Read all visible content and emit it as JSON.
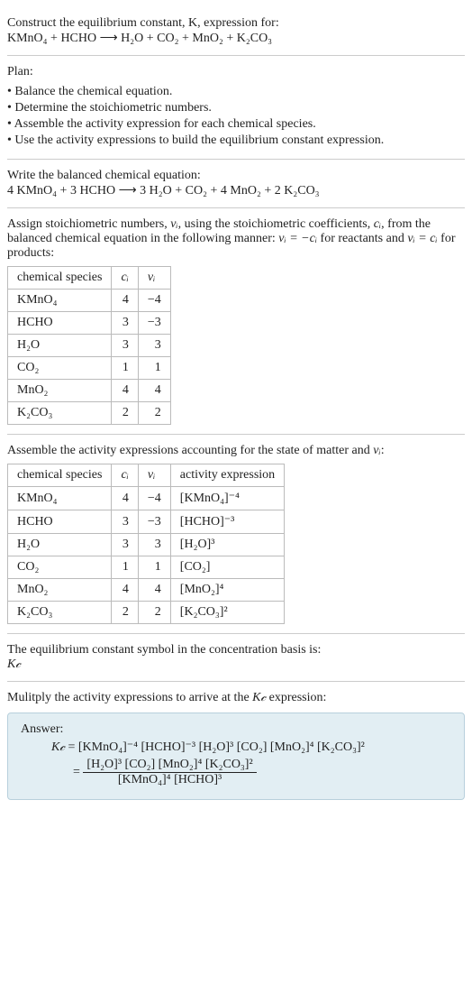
{
  "title": {
    "line1": "Construct the equilibrium constant, K, expression for:",
    "equation": "KMnO₄ + HCHO ⟶ H₂O + CO₂ + MnO₂ + K₂CO₃"
  },
  "plan": {
    "heading": "Plan:",
    "items": [
      "Balance the chemical equation.",
      "Determine the stoichiometric numbers.",
      "Assemble the activity expression for each chemical species.",
      "Use the activity expressions to build the equilibrium constant expression."
    ]
  },
  "balanced": {
    "heading": "Write the balanced chemical equation:",
    "equation": "4 KMnO₄ + 3 HCHO ⟶ 3 H₂O + CO₂ + 4 MnO₂ + 2 K₂CO₃"
  },
  "stoich": {
    "heading_part1": "Assign stoichiometric numbers, ",
    "heading_nu": "νᵢ",
    "heading_part2": ", using the stoichiometric coefficients, ",
    "heading_ci": "cᵢ",
    "heading_part3": ", from the balanced chemical equation in the following manner: ",
    "heading_eq1": "νᵢ = −cᵢ",
    "heading_part4": " for reactants and ",
    "heading_eq2": "νᵢ = cᵢ",
    "heading_part5": " for products:",
    "headers": [
      "chemical species",
      "cᵢ",
      "νᵢ"
    ],
    "rows": [
      {
        "species": "KMnO₄",
        "c": "4",
        "nu": "−4"
      },
      {
        "species": "HCHO",
        "c": "3",
        "nu": "−3"
      },
      {
        "species": "H₂O",
        "c": "3",
        "nu": "3"
      },
      {
        "species": "CO₂",
        "c": "1",
        "nu": "1"
      },
      {
        "species": "MnO₂",
        "c": "4",
        "nu": "4"
      },
      {
        "species": "K₂CO₃",
        "c": "2",
        "nu": "2"
      }
    ]
  },
  "activity": {
    "heading_part1": "Assemble the activity expressions accounting for the state of matter and ",
    "heading_nu": "νᵢ",
    "heading_part2": ":",
    "headers": [
      "chemical species",
      "cᵢ",
      "νᵢ",
      "activity expression"
    ],
    "rows": [
      {
        "species": "KMnO₄",
        "c": "4",
        "nu": "−4",
        "expr": "[KMnO₄]⁻⁴"
      },
      {
        "species": "HCHO",
        "c": "3",
        "nu": "−3",
        "expr": "[HCHO]⁻³"
      },
      {
        "species": "H₂O",
        "c": "3",
        "nu": "3",
        "expr": "[H₂O]³"
      },
      {
        "species": "CO₂",
        "c": "1",
        "nu": "1",
        "expr": "[CO₂]"
      },
      {
        "species": "MnO₂",
        "c": "4",
        "nu": "4",
        "expr": "[MnO₂]⁴"
      },
      {
        "species": "K₂CO₃",
        "c": "2",
        "nu": "2",
        "expr": "[K₂CO₃]²"
      }
    ]
  },
  "symbol": {
    "heading": "The equilibrium constant symbol in the concentration basis is:",
    "sym": "K𝒸"
  },
  "multiply": {
    "heading_part1": "Mulitply the activity expressions to arrive at the ",
    "heading_kc": "K𝒸",
    "heading_part2": " expression:"
  },
  "answer": {
    "label": "Answer:",
    "kc": "K𝒸",
    "line1_rhs": " = [KMnO₄]⁻⁴ [HCHO]⁻³ [H₂O]³ [CO₂] [MnO₂]⁴ [K₂CO₃]²",
    "frac_top": "[H₂O]³ [CO₂] [MnO₂]⁴ [K₂CO₃]²",
    "frac_bot": "[KMnO₄]⁴ [HCHO]³",
    "equals": " = "
  }
}
